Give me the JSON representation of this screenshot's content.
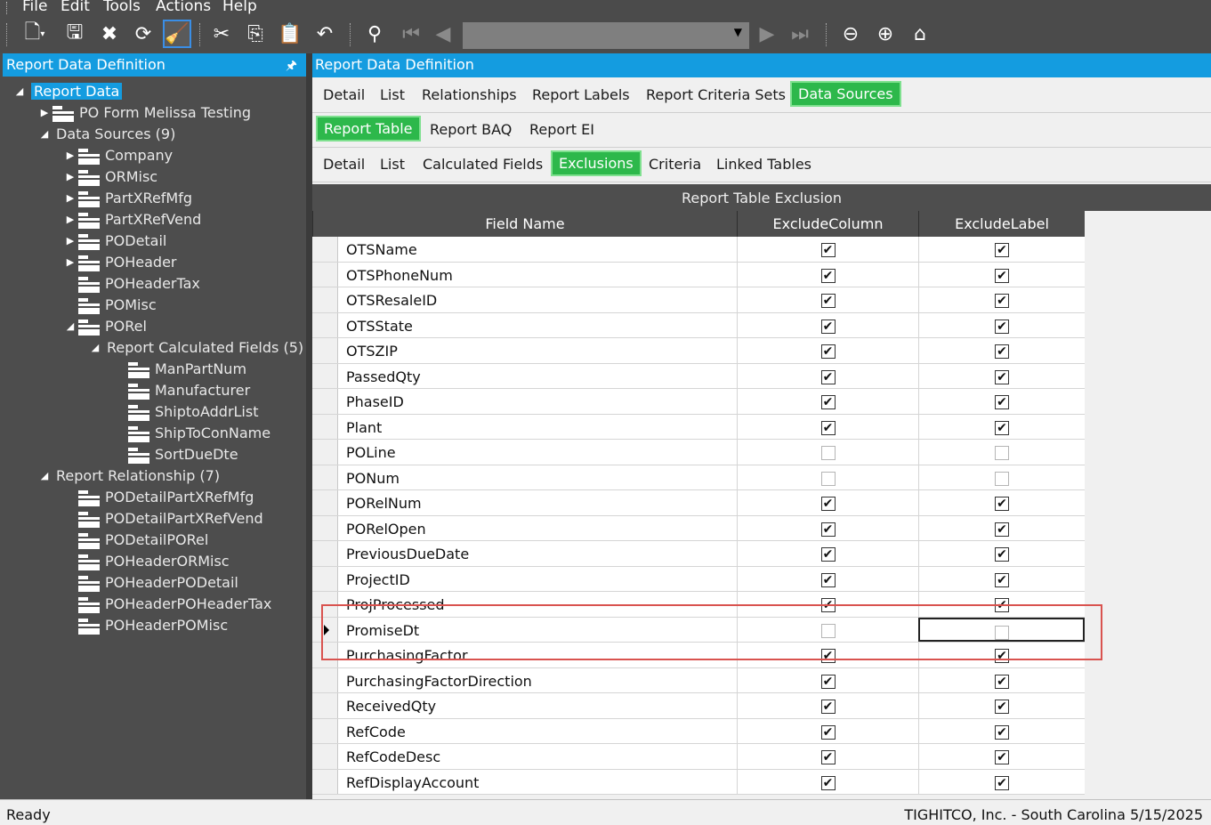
{
  "menu": {
    "file": "File",
    "edit": "Edit",
    "tools": "Tools",
    "actions": "Actions",
    "help": "Help"
  },
  "left_panel": {
    "title": "Report Data Definition",
    "pin": "🖈"
  },
  "right_panel": {
    "title": "Report Data Definition"
  },
  "tree": [
    {
      "label": "Report Data",
      "expander": "◢",
      "folder": false,
      "selected": true
    },
    {
      "label": "PO Form Melissa Testing",
      "expander": "▶",
      "folder": true
    },
    {
      "label": "Data Sources (9)",
      "expander": "◢",
      "folder": false
    },
    {
      "label": "Company",
      "expander": "▶",
      "folder": true
    },
    {
      "label": "ORMisc",
      "expander": "▶",
      "folder": true
    },
    {
      "label": "PartXRefMfg",
      "expander": "▶",
      "folder": true
    },
    {
      "label": "PartXRefVend",
      "expander": "▶",
      "folder": true
    },
    {
      "label": "PODetail",
      "expander": "▶",
      "folder": true
    },
    {
      "label": "POHeader",
      "expander": "▶",
      "folder": true
    },
    {
      "label": "POHeaderTax",
      "expander": "",
      "folder": true
    },
    {
      "label": "POMisc",
      "expander": "",
      "folder": true
    },
    {
      "label": "PORel",
      "expander": "◢",
      "folder": true
    },
    {
      "label": "Report Calculated Fields (5)",
      "expander": "◢",
      "folder": false
    },
    {
      "label": "ManPartNum",
      "expander": "",
      "folder": true
    },
    {
      "label": "Manufacturer",
      "expander": "",
      "folder": true
    },
    {
      "label": "ShiptoAddrList",
      "expander": "",
      "folder": true
    },
    {
      "label": "ShipToConName",
      "expander": "",
      "folder": true
    },
    {
      "label": "SortDueDte",
      "expander": "",
      "folder": true
    },
    {
      "label": "Report Relationship (7)",
      "expander": "◢",
      "folder": false
    },
    {
      "label": "PODetailPartXRefMfg",
      "expander": "",
      "folder": true
    },
    {
      "label": "PODetailPartXRefVend",
      "expander": "",
      "folder": true
    },
    {
      "label": "PODetailPORel",
      "expander": "",
      "folder": true
    },
    {
      "label": "POHeaderORMisc",
      "expander": "",
      "folder": true
    },
    {
      "label": "POHeaderPODetail",
      "expander": "",
      "folder": true
    },
    {
      "label": "POHeaderPOHeaderTax",
      "expander": "",
      "folder": true
    },
    {
      "label": "POHeaderPOMisc",
      "expander": "",
      "folder": true
    }
  ],
  "tabs1": [
    "Detail",
    "List",
    "Relationships",
    "Report Labels",
    "Report Criteria Sets",
    "Data Sources"
  ],
  "tabs2": [
    "Report Table",
    "Report BAQ",
    "Report EI"
  ],
  "tabs3": [
    "Detail",
    "List",
    "Calculated Fields",
    "Exclusions",
    "Criteria",
    "Linked Tables"
  ],
  "grid": {
    "title": "Report Table Exclusion",
    "headers": [
      "Field Name",
      "ExcludeColumn",
      "ExcludeLabel"
    ],
    "rows": [
      {
        "field": "OTSName",
        "exclude_column": true,
        "exclude_label": true
      },
      {
        "field": "OTSPhoneNum",
        "exclude_column": true,
        "exclude_label": true
      },
      {
        "field": "OTSResaleID",
        "exclude_column": true,
        "exclude_label": true
      },
      {
        "field": "OTSState",
        "exclude_column": true,
        "exclude_label": true
      },
      {
        "field": "OTSZIP",
        "exclude_column": true,
        "exclude_label": true
      },
      {
        "field": "PassedQty",
        "exclude_column": true,
        "exclude_label": true
      },
      {
        "field": "PhaseID",
        "exclude_column": true,
        "exclude_label": true
      },
      {
        "field": "Plant",
        "exclude_column": true,
        "exclude_label": true
      },
      {
        "field": "POLine",
        "exclude_column": false,
        "exclude_label": false
      },
      {
        "field": "PONum",
        "exclude_column": false,
        "exclude_label": false
      },
      {
        "field": "PORelNum",
        "exclude_column": true,
        "exclude_label": true
      },
      {
        "field": "PORelOpen",
        "exclude_column": true,
        "exclude_label": true
      },
      {
        "field": "PreviousDueDate",
        "exclude_column": true,
        "exclude_label": true
      },
      {
        "field": "ProjectID",
        "exclude_column": true,
        "exclude_label": true
      },
      {
        "field": "ProjProcessed",
        "exclude_column": true,
        "exclude_label": true
      },
      {
        "field": "PromiseDt",
        "exclude_column": false,
        "exclude_label": false,
        "current": true
      },
      {
        "field": "PurchasingFactor",
        "exclude_column": true,
        "exclude_label": true
      },
      {
        "field": "PurchasingFactorDirection",
        "exclude_column": true,
        "exclude_label": true
      },
      {
        "field": "ReceivedQty",
        "exclude_column": true,
        "exclude_label": true
      },
      {
        "field": "RefCode",
        "exclude_column": true,
        "exclude_label": true
      },
      {
        "field": "RefCodeDesc",
        "exclude_column": true,
        "exclude_label": true
      },
      {
        "field": "RefDisplayAccount",
        "exclude_column": true,
        "exclude_label": true
      }
    ]
  },
  "status": {
    "left": "Ready",
    "right": "TIGHITCO, Inc. - South Carolina  5/15/2025"
  },
  "check_glyph": "✔"
}
